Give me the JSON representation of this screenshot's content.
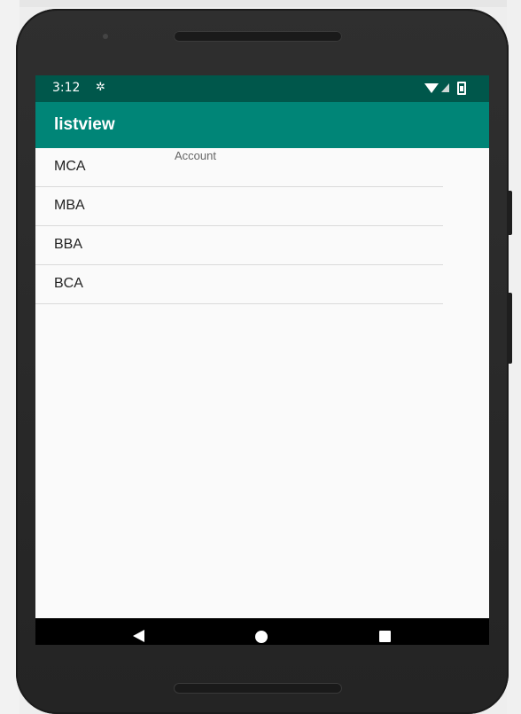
{
  "status_bar": {
    "time": "3:12",
    "icons": [
      "gear-icon",
      "wifi-icon",
      "signal-icon",
      "battery-icon"
    ]
  },
  "app_bar": {
    "title": "listview"
  },
  "overlay_label": "Account",
  "list": {
    "items": [
      {
        "label": "MCA"
      },
      {
        "label": "MBA"
      },
      {
        "label": "BBA"
      },
      {
        "label": "BCA"
      }
    ]
  },
  "nav_bar": {
    "icons": [
      "back-icon",
      "home-icon",
      "recents-icon"
    ]
  },
  "colors": {
    "status_bar": "#00574b",
    "app_bar": "#008577",
    "screen_bg": "#fafafa",
    "nav_bar": "#000000"
  }
}
